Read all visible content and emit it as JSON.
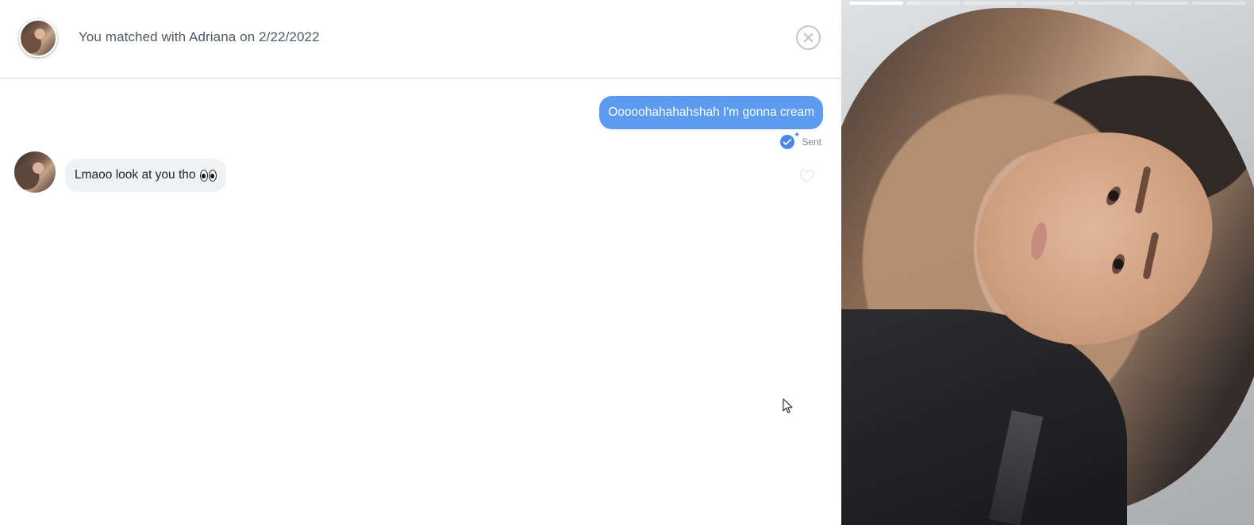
{
  "chat": {
    "match_text": "You matched with Adriana on 2/22/2022",
    "messages": {
      "sent_text": "Ooooohahahahshah I'm gonna cream",
      "sent_status": "Sent",
      "received_text": "Lmaoo look at you tho"
    }
  },
  "profile": {
    "photo_count": 7,
    "active_photo_index": 1
  },
  "icons": {
    "close": "close-icon",
    "seen": "seen-check-icon",
    "like": "heart-icon",
    "eyes": "eyes-emoji"
  },
  "colors": {
    "sent_bubble": "#5b9bf0",
    "received_bubble": "#f0f1f3",
    "seen_badge": "#4f86e8"
  }
}
